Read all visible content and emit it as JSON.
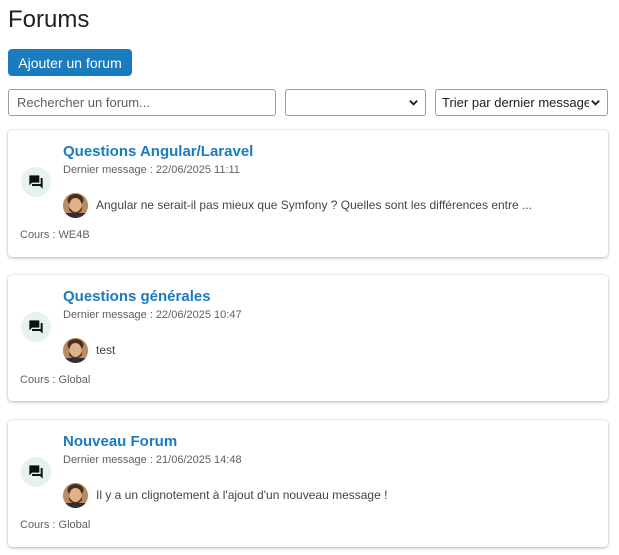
{
  "header": {
    "title": "Forums",
    "add_button_label": "Ajouter un forum"
  },
  "filters": {
    "search_placeholder": "Rechercher un forum...",
    "course_select_value": "",
    "sort_select_value": "Trier par dernier message"
  },
  "forums": [
    {
      "title": "Questions Angular/Laravel",
      "last_message": "Dernier message : 22/06/2025 11:11",
      "preview": "Angular ne serait-il pas mieux que Symfony ? Quelles sont les différences entre ...",
      "course": "Cours : WE4B"
    },
    {
      "title": "Questions générales",
      "last_message": "Dernier message : 22/06/2025 10:47",
      "preview": "test",
      "course": "Cours : Global"
    },
    {
      "title": "Nouveau Forum",
      "last_message": "Dernier message : 21/06/2025 14:48",
      "preview": "Il y a un clignotement à l'ajout d'un nouveau message !",
      "course": "Cours : Global"
    }
  ],
  "icons": {
    "forum": "forum-icon",
    "avatar": "user-avatar",
    "select_chevron": "chevron-down-icon"
  },
  "colors": {
    "primary": "#1a7bbf",
    "icon_bg": "#e6f3ec",
    "text_muted": "#616161"
  }
}
